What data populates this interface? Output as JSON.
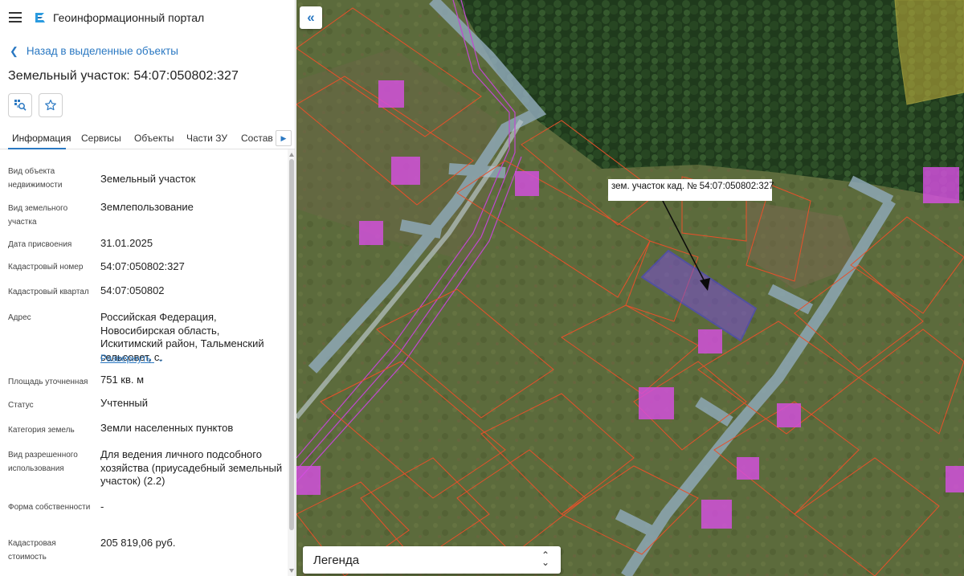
{
  "app": {
    "title": "Геоинформационный портал",
    "menu_icon": "hamburger-icon",
    "logo_icon": "portal-logo-icon"
  },
  "nav": {
    "back_label": "Назад в выделенные объекты"
  },
  "object": {
    "title": "Земельный участок: 54:07:050802:327"
  },
  "actions": {
    "locate_icon": "locate-on-map-icon",
    "favorite_icon": "star-icon"
  },
  "tabs": [
    {
      "label": "Информация",
      "active": true
    },
    {
      "label": "Сервисы"
    },
    {
      "label": "Объекты"
    },
    {
      "label": "Части ЗУ"
    },
    {
      "label": "Состав ЕЗП"
    }
  ],
  "properties": [
    {
      "label": "Вид объекта недвижимости",
      "value": "Земельный участок"
    },
    {
      "label": "Вид земельного участка",
      "value": "Землепользование"
    },
    {
      "label": "Дата присвоения",
      "value": "31.01.2025"
    },
    {
      "label": "Кадастровый номер",
      "value": "54:07:050802:327"
    },
    {
      "label": "Кадастровый квартал",
      "value": "54:07:050802"
    },
    {
      "label": "Адрес",
      "value": "Российская Федерация, Новосибирская область, Искитимский район, Тальменский сельсовет, с.",
      "expand_label": "Развернуть"
    },
    {
      "label": "Площадь уточненная",
      "value": "751 кв. м"
    },
    {
      "label": "Статус",
      "value": "Учтенный"
    },
    {
      "label": "Категория земель",
      "value": "Земли населенных пунктов"
    },
    {
      "label": "Вид разрешенного использования",
      "value": "Для ведения личного подсобного хозяйства (приусадебный земельный участок) (2.2)"
    },
    {
      "label": "Форма собственности",
      "value": "-"
    },
    {
      "label": "Кадастровая стоимость",
      "value": "205 819,06 руб."
    }
  ],
  "map": {
    "collapse_icon": "double-chevron-left-icon",
    "parcel_label": "зем. участок кад. № 54:07:050802:327",
    "legend_title": "Легенда",
    "legend_icon": "chevron-up-down-icon",
    "colors": {
      "parcel_border": "#e8502a",
      "selected_parcel": "#4b3cf0",
      "building": "#d64fe0",
      "road": "#8ea8b6"
    }
  }
}
